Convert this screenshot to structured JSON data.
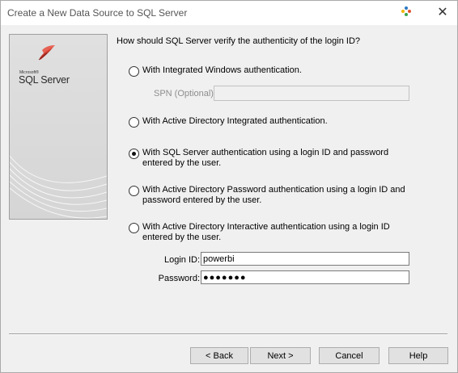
{
  "window": {
    "title": "Create a New Data Source to SQL Server",
    "close_glyph": "✕"
  },
  "logo": {
    "brand_small": "Microsoft®",
    "brand": "SQL Server"
  },
  "question": "How should SQL Server verify the authenticity of the login ID?",
  "auth_options": [
    {
      "label": "With Integrated Windows authentication.",
      "selected": false
    },
    {
      "label": "With Active Directory Integrated authentication.",
      "selected": false
    },
    {
      "label": "With SQL Server authentication using a login ID and password entered by the user.",
      "selected": true
    },
    {
      "label": "With Active Directory Password authentication using a login ID and password entered by the user.",
      "selected": false
    },
    {
      "label": "With Active Directory Interactive authentication using a login ID entered by the user.",
      "selected": false
    }
  ],
  "spn": {
    "label": "SPN (Optional):",
    "value": ""
  },
  "login": {
    "label": "Login ID:",
    "value": "powerbi"
  },
  "password": {
    "label": "Password:",
    "value": "●●●●●●●"
  },
  "buttons": {
    "back": "< Back",
    "next": "Next >",
    "cancel": "Cancel",
    "help": "Help"
  },
  "colors": {
    "panel_bg": "#f0f0f0",
    "logo_bg": "#d9d9d9",
    "logo_accent": "#c0392b"
  }
}
